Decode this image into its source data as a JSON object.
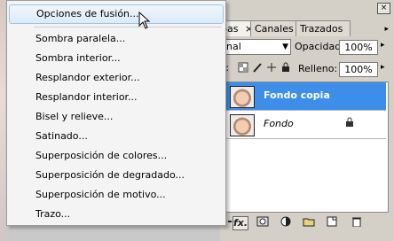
{
  "menu": {
    "items": [
      "Opciones de fusión...",
      "Sombra paralela...",
      "Sombra interior...",
      "Resplandor exterior...",
      "Resplandor interior...",
      "Bisel y relieve...",
      "Satinado...",
      "Superposición de colores...",
      "Superposición de degradado...",
      "Superposición de motivo...",
      "Trazo..."
    ]
  },
  "panel": {
    "close_glyph": "×",
    "menu_arrow": "▸",
    "tabs": [
      "pas",
      "Canales",
      "Trazados"
    ],
    "tab_close": "×",
    "blend_mode": "nal",
    "opacity_label": "Opacidad:",
    "opacity_value": "100%",
    "lock_label": "r:",
    "fill_label": "Relleno:",
    "fill_value": "100%",
    "dropdown_arrow": "▼",
    "spin_arrow": "▸",
    "lock_icons": [
      "lock-transparent-icon",
      "lock-paint-icon",
      "lock-move-icon",
      "lock-all-icon"
    ],
    "layers": [
      {
        "name": "Fondo copia",
        "selected": true,
        "locked": false
      },
      {
        "name": "Fondo",
        "selected": false,
        "locked": true
      }
    ],
    "footer_icons": [
      "link-icon",
      "fx-icon",
      "mask-icon",
      "adjustment-icon",
      "group-icon",
      "new-layer-icon",
      "trash-icon"
    ],
    "fx_label": "fx."
  },
  "colors": {
    "selected_layer": "#3d8ee8",
    "menu_highlight_border": "#9ec3e6"
  }
}
